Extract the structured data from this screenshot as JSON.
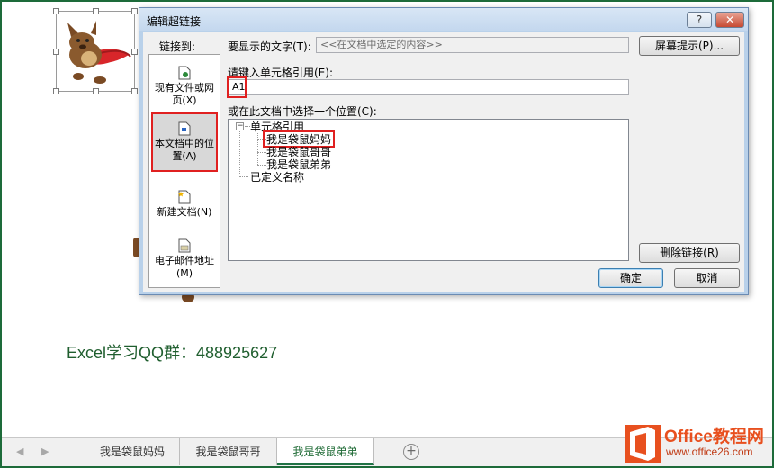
{
  "dialog": {
    "title": "编辑超链接",
    "help_label": "?",
    "close_label": "✕",
    "link_to_label": "链接到:",
    "text_to_display_label": "要显示的文字(T):",
    "text_to_display_value": "<<在文档中选定的内容>>",
    "screen_tip_label": "屏幕提示(P)...",
    "cell_ref_label": "请键入单元格引用(E):",
    "cell_ref_value": "A1",
    "select_place_label": "或在此文档中选择一个位置(C):",
    "remove_link_label": "删除链接(R)",
    "ok_label": "确定",
    "cancel_label": "取消"
  },
  "sidebar": {
    "items": [
      {
        "label": "现有文件或网页(X)"
      },
      {
        "label": "本文档中的位置(A)"
      },
      {
        "label": "新建文档(N)"
      },
      {
        "label": "电子邮件地址(M)"
      }
    ]
  },
  "tree": {
    "cell_reference": "单元格引用",
    "sheets": [
      "我是袋鼠妈妈",
      "我是袋鼠哥哥",
      "我是袋鼠弟弟"
    ],
    "defined_names": "已定义名称",
    "collapse_symbol": "−"
  },
  "sheet": {
    "qq_text": "Excel学习QQ群：488925627"
  },
  "tabs": {
    "prev_symbol": "◀",
    "next_symbol": "▶",
    "items": [
      "我是袋鼠妈妈",
      "我是袋鼠哥哥",
      "我是袋鼠弟弟"
    ],
    "add_symbol": "+"
  },
  "watermark": {
    "title": "Office教程网",
    "url": "www.office26.com"
  },
  "colors": {
    "accent_green": "#217346",
    "highlight_red": "#e02020",
    "brand_orange": "#e8501f"
  }
}
